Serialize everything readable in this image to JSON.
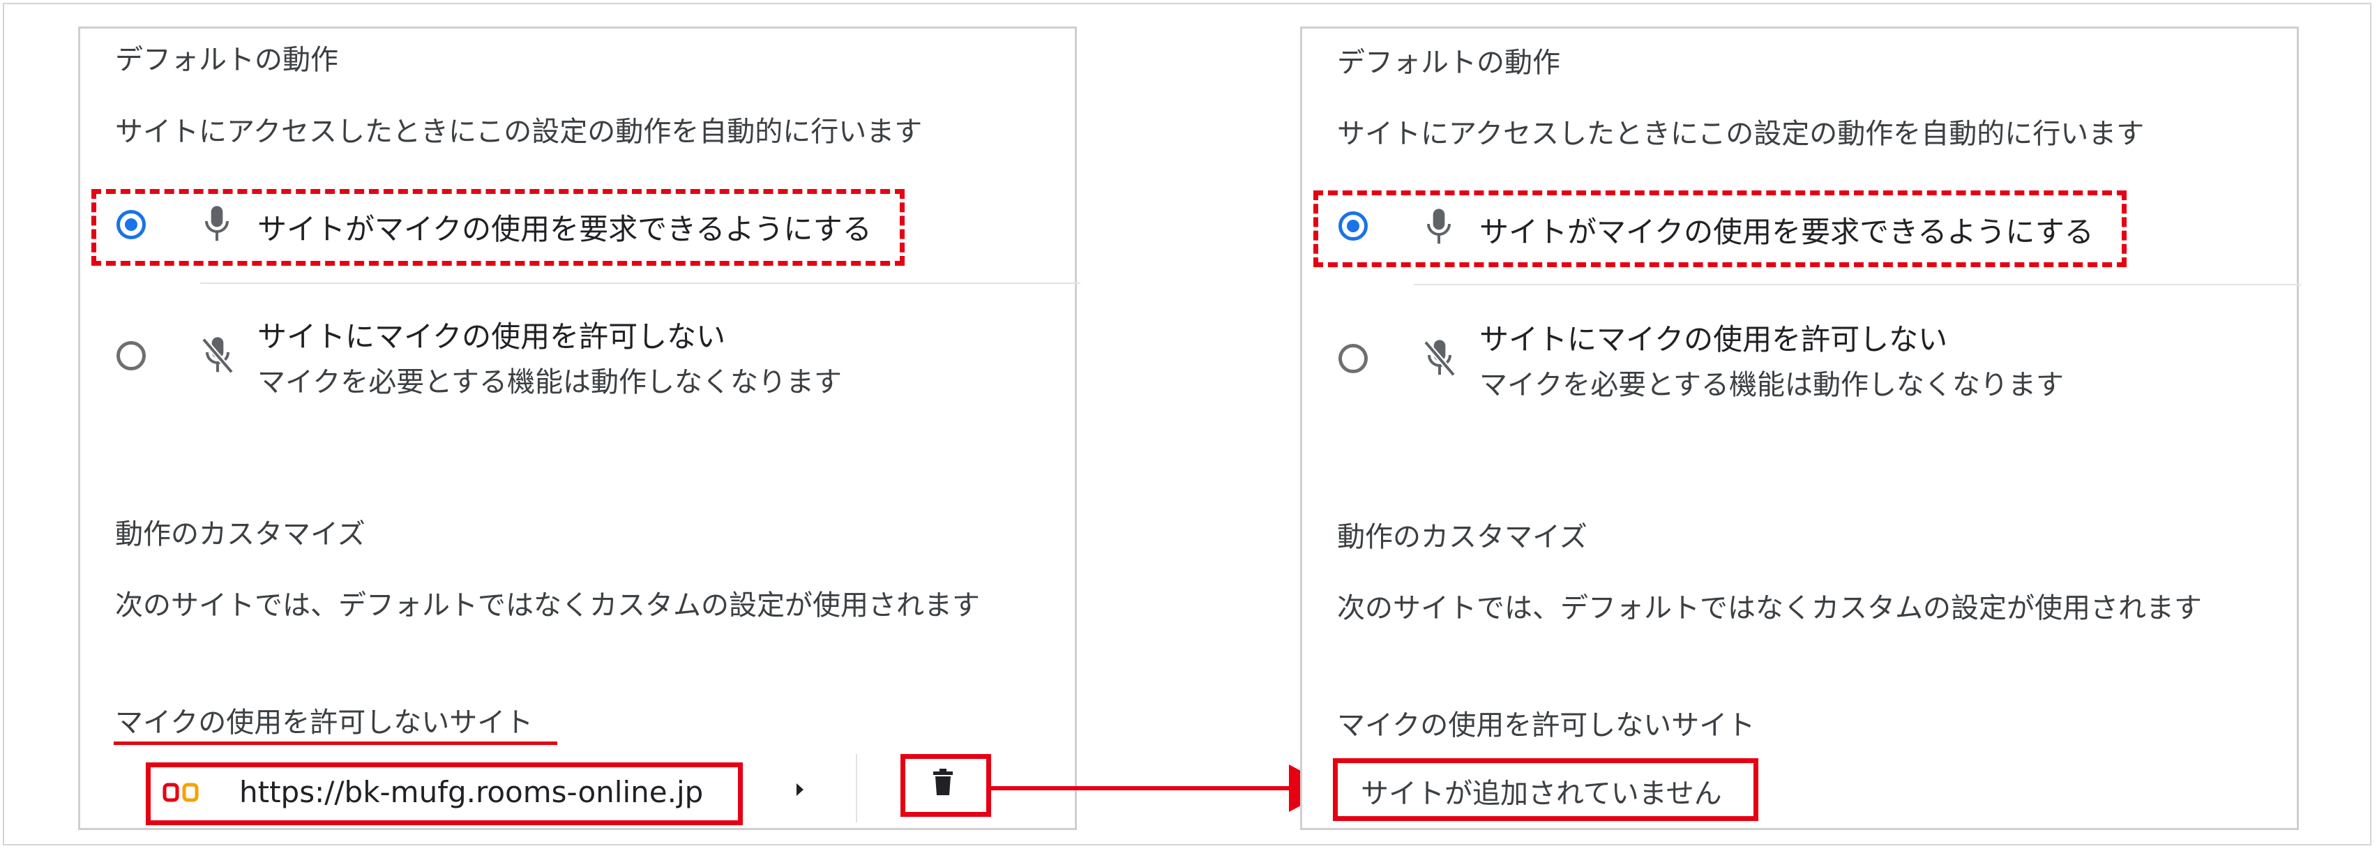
{
  "left": {
    "default_heading": "デフォルトの動作",
    "default_desc": "サイトにアクセスしたときにこの設定の動作を自動的に行います",
    "option_allow": "サイトがマイクの使用を要求できるようにする",
    "option_block": "サイトにマイクの使用を許可しない",
    "option_block_sub": "マイクを必要とする機能は動作しなくなります",
    "custom_heading": "動作のカスタマイズ",
    "custom_desc": "次のサイトでは、デフォルトではなくカスタムの設定が使用されます",
    "blocked_heading": "マイクの使用を許可しないサイト",
    "site_url": "https://bk-mufg.rooms-online.jp"
  },
  "right": {
    "default_heading": "デフォルトの動作",
    "default_desc": "サイトにアクセスしたときにこの設定の動作を自動的に行います",
    "option_allow": "サイトがマイクの使用を要求できるようにする",
    "option_block": "サイトにマイクの使用を許可しない",
    "option_block_sub": "マイクを必要とする機能は動作しなくなります",
    "custom_heading": "動作のカスタマイズ",
    "custom_desc": "次のサイトでは、デフォルトではなくカスタムの設定が使用されます",
    "blocked_heading": "マイクの使用を許可しないサイト",
    "empty_text": "サイトが追加されていません"
  },
  "colors": {
    "accent": "#1a73e8",
    "highlight": "#e60012"
  },
  "icons": {
    "mic": "mic-icon",
    "mic_off": "mic-off-icon",
    "expand": "expand-arrow-icon",
    "delete": "trash-icon",
    "site": "site-favicon"
  }
}
